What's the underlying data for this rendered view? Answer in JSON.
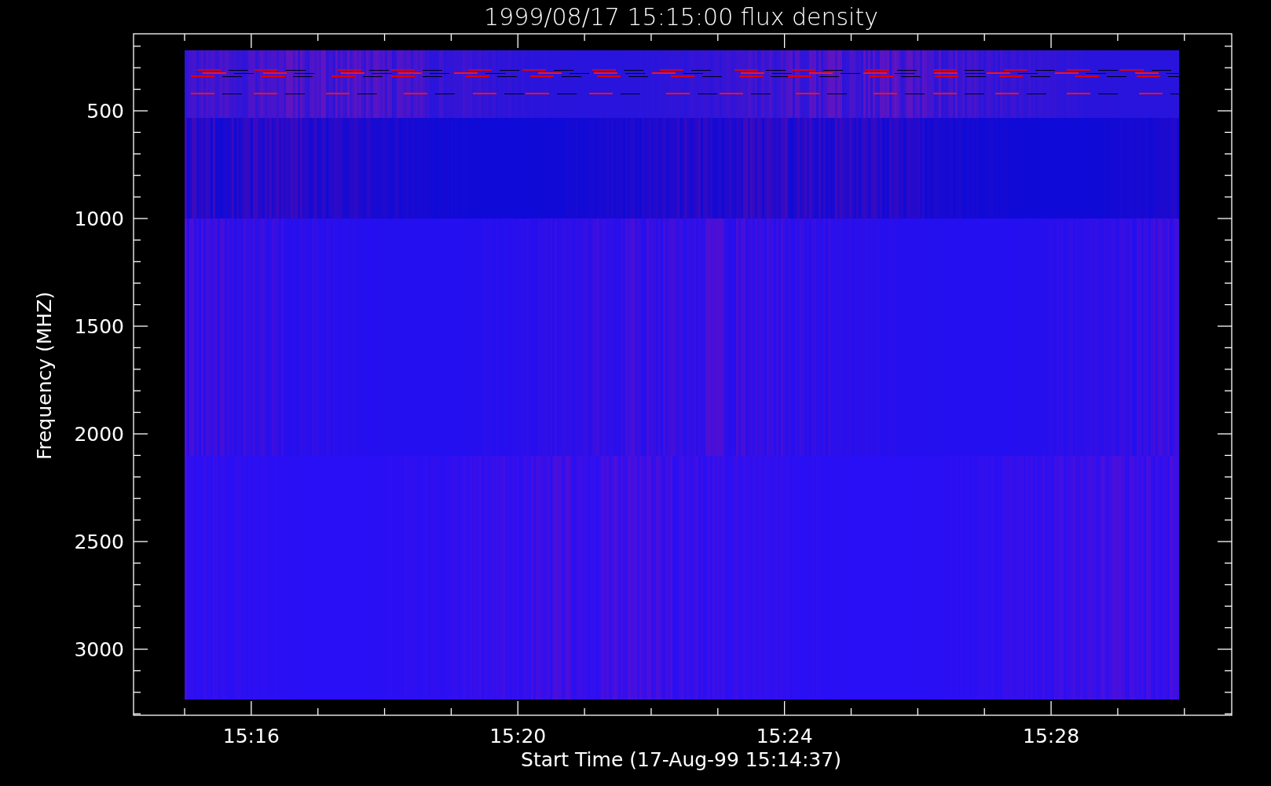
{
  "title": "1999/08/17 15:15:00 flux density",
  "y_axis": {
    "label": "Frequency (MHZ)",
    "ticks": [
      "500",
      "1000",
      "1500",
      "2000",
      "2500",
      "3000"
    ]
  },
  "x_axis": {
    "label": "Start Time (17-Aug-99 15:14:37)",
    "ticks": [
      "15:16",
      "15:20",
      "15:24",
      "15:28"
    ]
  }
}
